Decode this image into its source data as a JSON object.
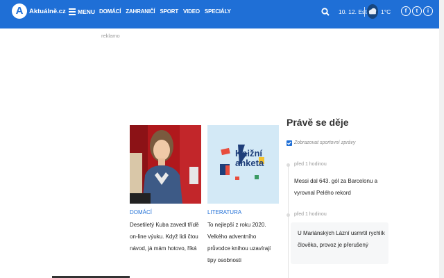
{
  "header": {
    "logo_letter": "A",
    "logo_text": "Aktuálně.cz",
    "menu_label": "MENU",
    "nav": [
      "DOMÁCÍ",
      "ZAHRANIČÍ",
      "SPORT",
      "VIDEO",
      "SPECIÁLY"
    ],
    "date": "10. 12. Ester",
    "temperature": "1°C",
    "social": [
      "f",
      "t",
      "i"
    ]
  },
  "ad_label": "reklamo",
  "cards": [
    {
      "category": "DOMÁCÍ",
      "text": "Desetiletý Kuba zavedl třídě on-line výuku. Když lidi čtou návod, já mám hotovo, říká"
    },
    {
      "category": "LITERATURA",
      "image_title": "Knižní anketa",
      "text": "To nejlepší z roku 2020. Velkého adventního průvodce knihou uzavírají tipy osobnosti"
    }
  ],
  "sidebar": {
    "title": "Právě se děje",
    "checkbox_label": "Zobrazovat sportovní zprávy",
    "items": [
      {
        "time": "před 1 hodinou",
        "text": "Messi dal 643. gól za Barcelonu a vyrovnal Pelého rekord"
      },
      {
        "time": "před 1 hodinou",
        "text": "U Mariánských Lázní usmrtil rychlík člověka, provoz je přerušený"
      }
    ]
  },
  "colors": {
    "brand": "#1f6fd6",
    "header_text": "#ffffff"
  }
}
